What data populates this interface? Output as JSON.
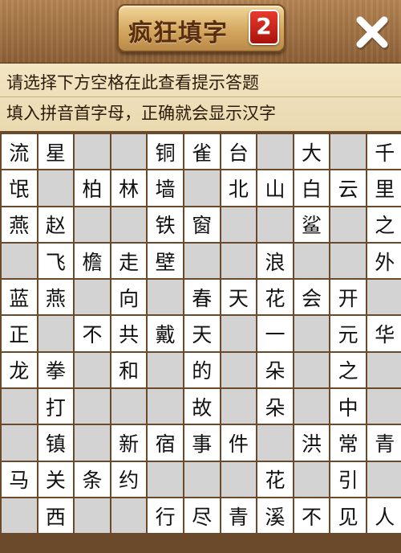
{
  "header": {
    "title": "疯狂填字",
    "version": "2",
    "close_icon": "close-x-icon"
  },
  "hints": {
    "line1": "请选择下方空格在此查看提示答题",
    "line2": "填入拼音首字母，正确就会显示汉字"
  },
  "grid": {
    "rows": [
      [
        "流",
        "星",
        "",
        "",
        "铜",
        "雀",
        "台",
        "",
        "大",
        "",
        "千"
      ],
      [
        "氓",
        "",
        "柏",
        "林",
        "墙",
        "",
        "北",
        "山",
        "白",
        "云",
        "里"
      ],
      [
        "燕",
        "赵",
        "",
        "",
        "铁",
        "窗",
        "",
        "",
        "鲨",
        "",
        "之"
      ],
      [
        "",
        "飞",
        "檐",
        "走",
        "壁",
        "",
        "",
        "浪",
        "",
        "",
        "外"
      ],
      [
        "蓝",
        "燕",
        "",
        "向",
        "",
        "春",
        "天",
        "花",
        "会",
        "开",
        ""
      ],
      [
        "正",
        "",
        "不",
        "共",
        "戴",
        "天",
        "",
        "一",
        "",
        "元",
        "华"
      ],
      [
        "龙",
        "拳",
        "",
        "和",
        "",
        "的",
        "",
        "朵",
        "",
        "之",
        ""
      ],
      [
        "",
        "打",
        "",
        "",
        "",
        "故",
        "",
        "朵",
        "",
        "中",
        ""
      ],
      [
        "",
        "镇",
        "",
        "新",
        "宿",
        "事",
        "件",
        "",
        "洪",
        "常",
        "青"
      ],
      [
        "马",
        "关",
        "条",
        "约",
        "",
        "",
        "",
        "花",
        "",
        "引",
        ""
      ],
      [
        "",
        "西",
        "",
        "",
        "行",
        "尽",
        "青",
        "溪",
        "不",
        "见",
        "人"
      ]
    ]
  }
}
